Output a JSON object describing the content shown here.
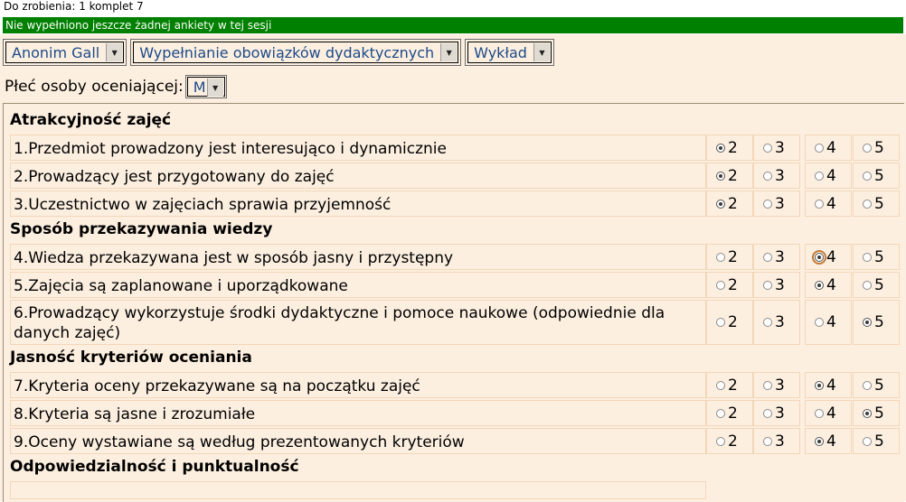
{
  "status": {
    "todo": "Do zrobienia: 1 komplet 7",
    "info": "Nie wypełniono jeszcze żadnej ankiety w tej sesji"
  },
  "selects": {
    "person": "Anonim Gall",
    "category": "Wypełnianie obowiązków dydaktycznych",
    "type": "Wykład"
  },
  "gender": {
    "label": "Płeć osoby oceniającej:",
    "value": "M"
  },
  "scale": [
    "2",
    "3",
    "4",
    "5"
  ],
  "sections": [
    {
      "title": "Atrakcyjność zajęć",
      "questions": [
        {
          "text": "1.Przedmiot prowadzony jest interesująco i dynamicznie",
          "selected": "2"
        },
        {
          "text": "2.Prowadzący jest przygotowany do zajęć",
          "selected": "2"
        },
        {
          "text": "3.Uczestnictwo w zajęciach sprawia przyjemność",
          "selected": "2"
        }
      ]
    },
    {
      "title": "Sposób przekazywania wiedzy",
      "questions": [
        {
          "text": "4.Wiedza przekazywana jest w sposób jasny i przystępny",
          "selected": "4"
        },
        {
          "text": "5.Zajęcia są zaplanowane i uporządkowane",
          "selected": "4"
        },
        {
          "text": "6.Prowadzący wykorzystuje środki dydaktyczne i pomoce naukowe (odpowiednie dla danych zajęć)",
          "selected": "5"
        }
      ]
    },
    {
      "title": "Jasność kryteriów oceniania",
      "questions": [
        {
          "text": "7.Kryteria oceny przekazywane są na początku zajęć",
          "selected": "4"
        },
        {
          "text": "8.Kryteria są jasne i zrozumiałe",
          "selected": "5"
        },
        {
          "text": "9.Oceny wystawiane są według prezentowanych kryteriów",
          "selected": "4"
        }
      ]
    },
    {
      "title": "Odpowiedzialność i punktualność",
      "questions": []
    }
  ]
}
